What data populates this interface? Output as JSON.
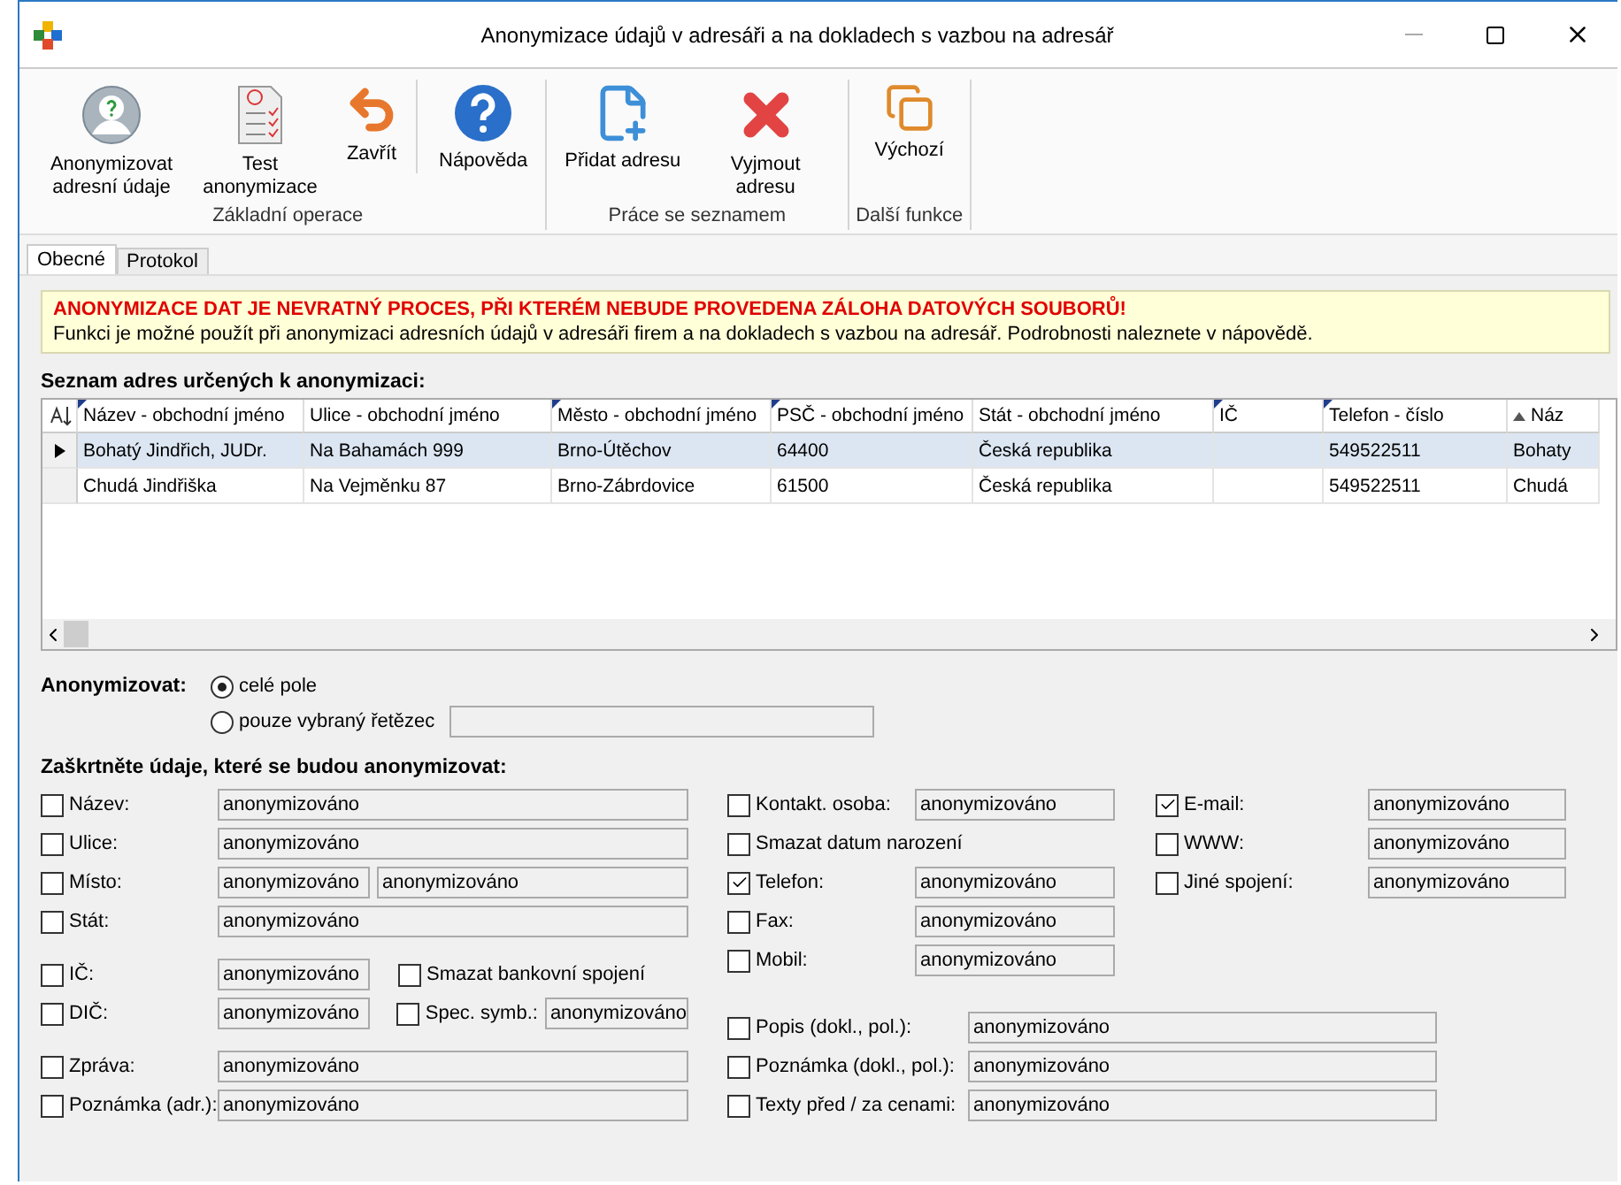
{
  "window": {
    "title": "Anonymizace údajů v adresáři a na dokladech s vazbou na adresář"
  },
  "toolbar": {
    "groups": [
      {
        "label": "Základní operace",
        "buttons": [
          {
            "kind": "anonymize",
            "label": "Anonymizovat adresní údaje"
          },
          {
            "kind": "test",
            "label": "Test anonymizace"
          },
          {
            "kind": "close",
            "label": "Zavřít"
          },
          {
            "kind": "help",
            "label": "Nápověda",
            "separated": true
          }
        ]
      },
      {
        "label": "Práce se seznamem",
        "buttons": [
          {
            "kind": "add",
            "label": "Přidat adresu"
          },
          {
            "kind": "remove",
            "label": "Vyjmout adresu"
          }
        ]
      },
      {
        "label": "Další funkce",
        "buttons": [
          {
            "kind": "default",
            "label": "Výchozí"
          }
        ]
      }
    ]
  },
  "tabs": [
    {
      "label": "Obecné",
      "selected": true
    },
    {
      "label": "Protokol",
      "selected": false
    }
  ],
  "warning": {
    "title": "ANONYMIZACE DAT JE NEVRATNÝ PROCES, PŘI KTERÉM NEBUDE PROVEDENA ZÁLOHA DATOVÝCH SOUBORŮ!",
    "text": "Funkci je možné použít při anonymizaci adresních údajů v adresáři firem a na dokladech s vazbou na adresář. Podrobnosti naleznete v nápovědě."
  },
  "table": {
    "title": "Seznam adres určených k anonymizaci:",
    "columns": [
      {
        "label": "Název - obchodní jméno",
        "filter": true
      },
      {
        "label": "Ulice - obchodní jméno",
        "filter": false
      },
      {
        "label": "Město - obchodní jméno",
        "filter": true
      },
      {
        "label": "PSČ - obchodní jméno",
        "filter": true
      },
      {
        "label": "Stát - obchodní jméno",
        "filter": false
      },
      {
        "label": "IČ",
        "filter": true
      },
      {
        "label": "Telefon - číslo",
        "filter": true
      },
      {
        "label": "Náz",
        "filter": false,
        "sorted": true
      }
    ],
    "rows": [
      {
        "selected": true,
        "cells": [
          "Bohatý Jindřich, JUDr.",
          "Na Bahamách 999",
          "Brno-Útěchov",
          "64400",
          "Česká republika",
          "",
          "549522511",
          "Bohaty"
        ]
      },
      {
        "selected": false,
        "cells": [
          "Chudá Jindřiška",
          "Na Vejměnku 87",
          "Brno-Zábrdovice",
          "61500",
          "Česká republika",
          "",
          "549522511",
          "Chudá"
        ]
      }
    ]
  },
  "mode": {
    "label": "Anonymizovat:",
    "options": [
      {
        "label": "celé pole",
        "selected": true
      },
      {
        "label": "pouze vybraný řetězec",
        "selected": false
      }
    ]
  },
  "fields": {
    "title": "Zaškrtněte údaje, které se budou anonymizovat:",
    "left_groups": [
      [
        {
          "label": "Název:",
          "checked": false,
          "values": [
            "anonymizováno"
          ]
        },
        {
          "label": "Ulice:",
          "checked": false,
          "values": [
            "anonymizováno"
          ]
        },
        {
          "label": "Místo:",
          "checked": false,
          "values": [
            "anonymizováno",
            "anonymizováno"
          ]
        },
        {
          "label": "Stát:",
          "checked": false,
          "values": [
            "anonymizováno"
          ]
        }
      ],
      [
        {
          "label": "IČ:",
          "checked": false,
          "values": [
            "anonymizováno"
          ],
          "extra": {
            "label": "Smazat bankovní spojení",
            "checked": false
          }
        },
        {
          "label": "DIČ:",
          "checked": false,
          "values": [
            "anonymizováno"
          ],
          "extra": {
            "label": "Spec. symb.:",
            "checked": false,
            "value": "anonymizováno"
          }
        }
      ],
      [
        {
          "label": "Zpráva:",
          "checked": false,
          "values": [
            "anonymizováno"
          ]
        },
        {
          "label": "Poznámka (adr.):",
          "checked": false,
          "values": [
            "anonymizováno"
          ]
        }
      ]
    ],
    "middle": [
      {
        "label": "Kontakt. osoba:",
        "checked": false,
        "values": [
          "anonymizováno"
        ]
      },
      {
        "label": "Smazat datum narození",
        "checked": false
      },
      {
        "label": "Telefon:",
        "checked": true,
        "values": [
          "anonymizováno"
        ]
      },
      {
        "label": "Fax:",
        "checked": false,
        "values": [
          "anonymizováno"
        ]
      },
      {
        "label": "Mobil:",
        "checked": false,
        "values": [
          "anonymizováno"
        ]
      }
    ],
    "right": [
      {
        "label": "E-mail:",
        "checked": true,
        "values": [
          "anonymizováno"
        ]
      },
      {
        "label": "WWW:",
        "checked": false,
        "values": [
          "anonymizováno"
        ]
      },
      {
        "label": "Jiné spojení:",
        "checked": false,
        "values": [
          "anonymizováno"
        ]
      }
    ],
    "documents": [
      {
        "label": "Popis (dokl., pol.):",
        "checked": false,
        "values": [
          "anonymizováno"
        ]
      },
      {
        "label": "Poznámka (dokl., pol.):",
        "checked": false,
        "values": [
          "anonymizováno"
        ]
      },
      {
        "label": "Texty před / za cenami:",
        "checked": false,
        "values": [
          "anonymizováno"
        ]
      }
    ]
  }
}
